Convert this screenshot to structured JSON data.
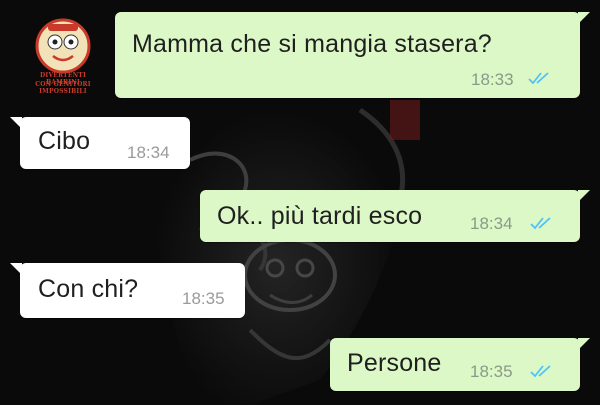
{
  "logo": {
    "line1": "DIVERTENTI BAMBINI",
    "line2": "CON GENITORI IMPOSSIBILI"
  },
  "messages": [
    {
      "text": "Mamma che si mangia stasera?",
      "time": "18:33",
      "direction": "outgoing",
      "status": "read-double-tick"
    },
    {
      "text": "Cibo",
      "time": "18:34",
      "direction": "incoming"
    },
    {
      "text": "Ok.. più tardi esco",
      "time": "18:34",
      "direction": "outgoing",
      "status": "read-double-tick"
    },
    {
      "text": "Con chi?",
      "time": "18:35",
      "direction": "incoming"
    },
    {
      "text": "Persone",
      "time": "18:35",
      "direction": "outgoing",
      "status": "read-double-tick"
    }
  ],
  "colors": {
    "outgoing_bubble": "#dcf8c6",
    "incoming_bubble": "#ffffff",
    "read_ticks": "#4fc3f7",
    "wallpaper": "#0b0b0b"
  }
}
